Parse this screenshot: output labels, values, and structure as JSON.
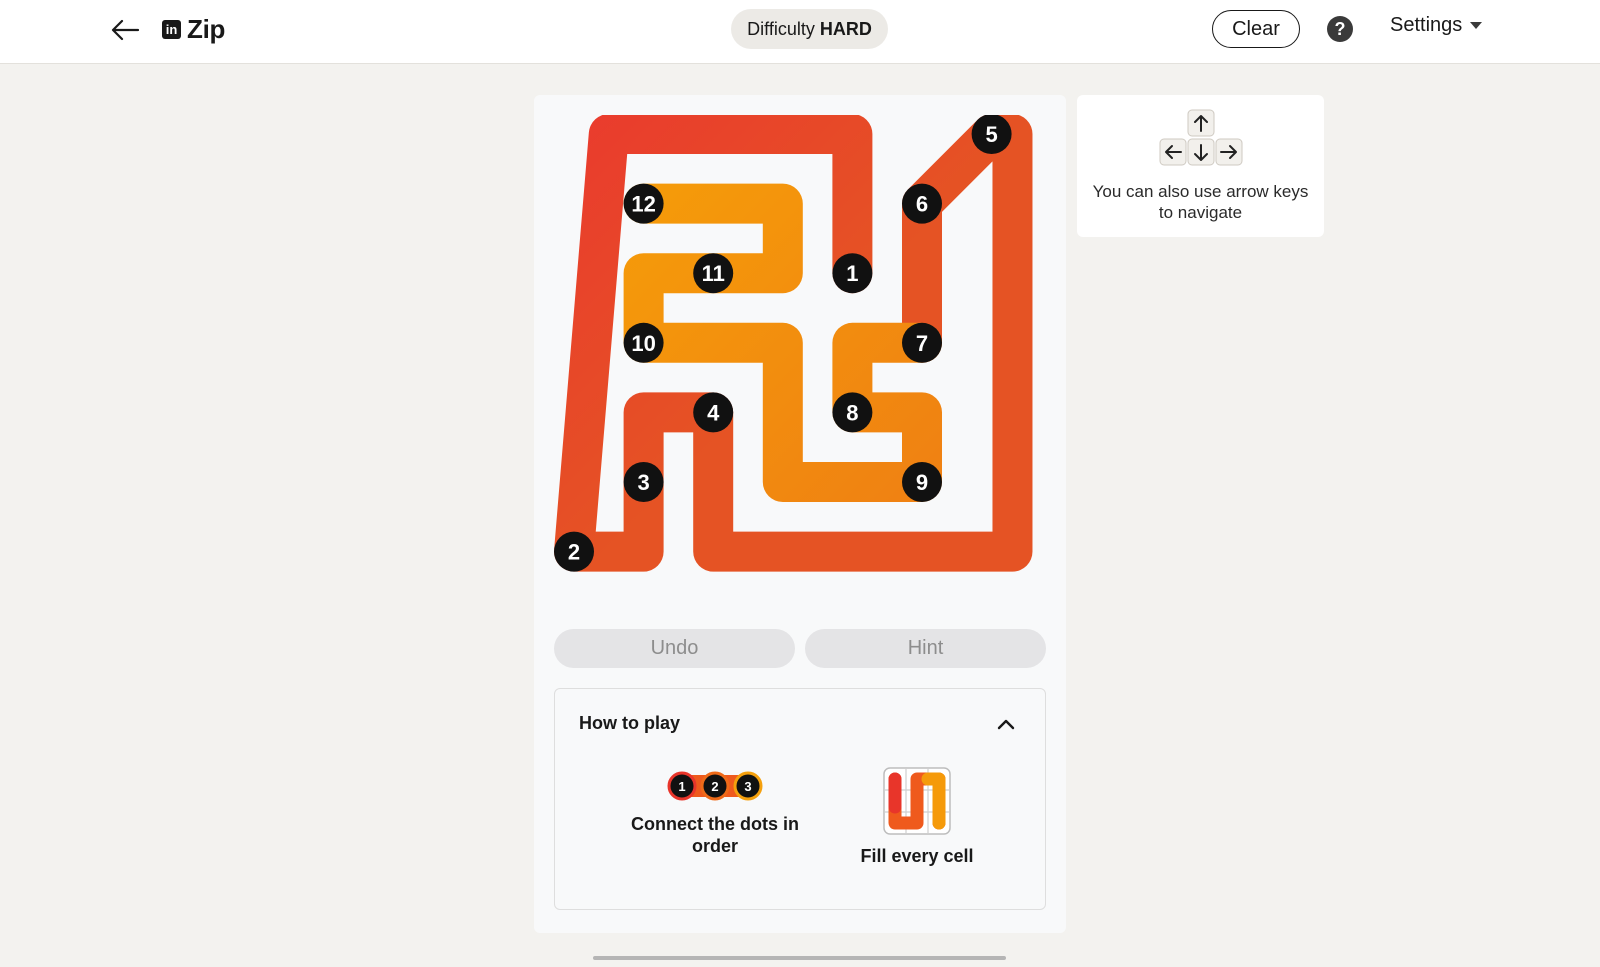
{
  "header": {
    "app_name": "Zip",
    "brand_logo_text": "in",
    "difficulty_label": "Difficulty",
    "difficulty_value": "HARD",
    "clear_label": "Clear",
    "help_label": "?",
    "settings_label": "Settings"
  },
  "game": {
    "grid_size": [
      6,
      7
    ],
    "path_colors": [
      "#ea3a2e",
      "#e55324",
      "#ef7f13",
      "#f59a0a"
    ],
    "dots": [
      {
        "label": "1",
        "col": 4,
        "row": 2
      },
      {
        "label": "2",
        "col": 0,
        "row": 6
      },
      {
        "label": "3",
        "col": 1,
        "row": 5
      },
      {
        "label": "4",
        "col": 2,
        "row": 4
      },
      {
        "label": "5",
        "col": 6,
        "row": 0
      },
      {
        "label": "6",
        "col": 5,
        "row": 1
      },
      {
        "label": "7",
        "col": 5,
        "row": 3
      },
      {
        "label": "8",
        "col": 4,
        "row": 4
      },
      {
        "label": "9",
        "col": 5,
        "row": 5
      },
      {
        "label": "10",
        "col": 1,
        "row": 3
      },
      {
        "label": "11",
        "col": 2,
        "row": 2
      },
      {
        "label": "12",
        "col": 1,
        "row": 1
      }
    ],
    "undo_label": "Undo",
    "hint_label": "Hint"
  },
  "how_to_play": {
    "title": "How to play",
    "rule1_dots": [
      "1",
      "2",
      "3"
    ],
    "rule1_text": "Connect the dots in order",
    "rule2_text": "Fill every cell"
  },
  "tip": {
    "text": "You can also use arrow keys to navigate"
  }
}
